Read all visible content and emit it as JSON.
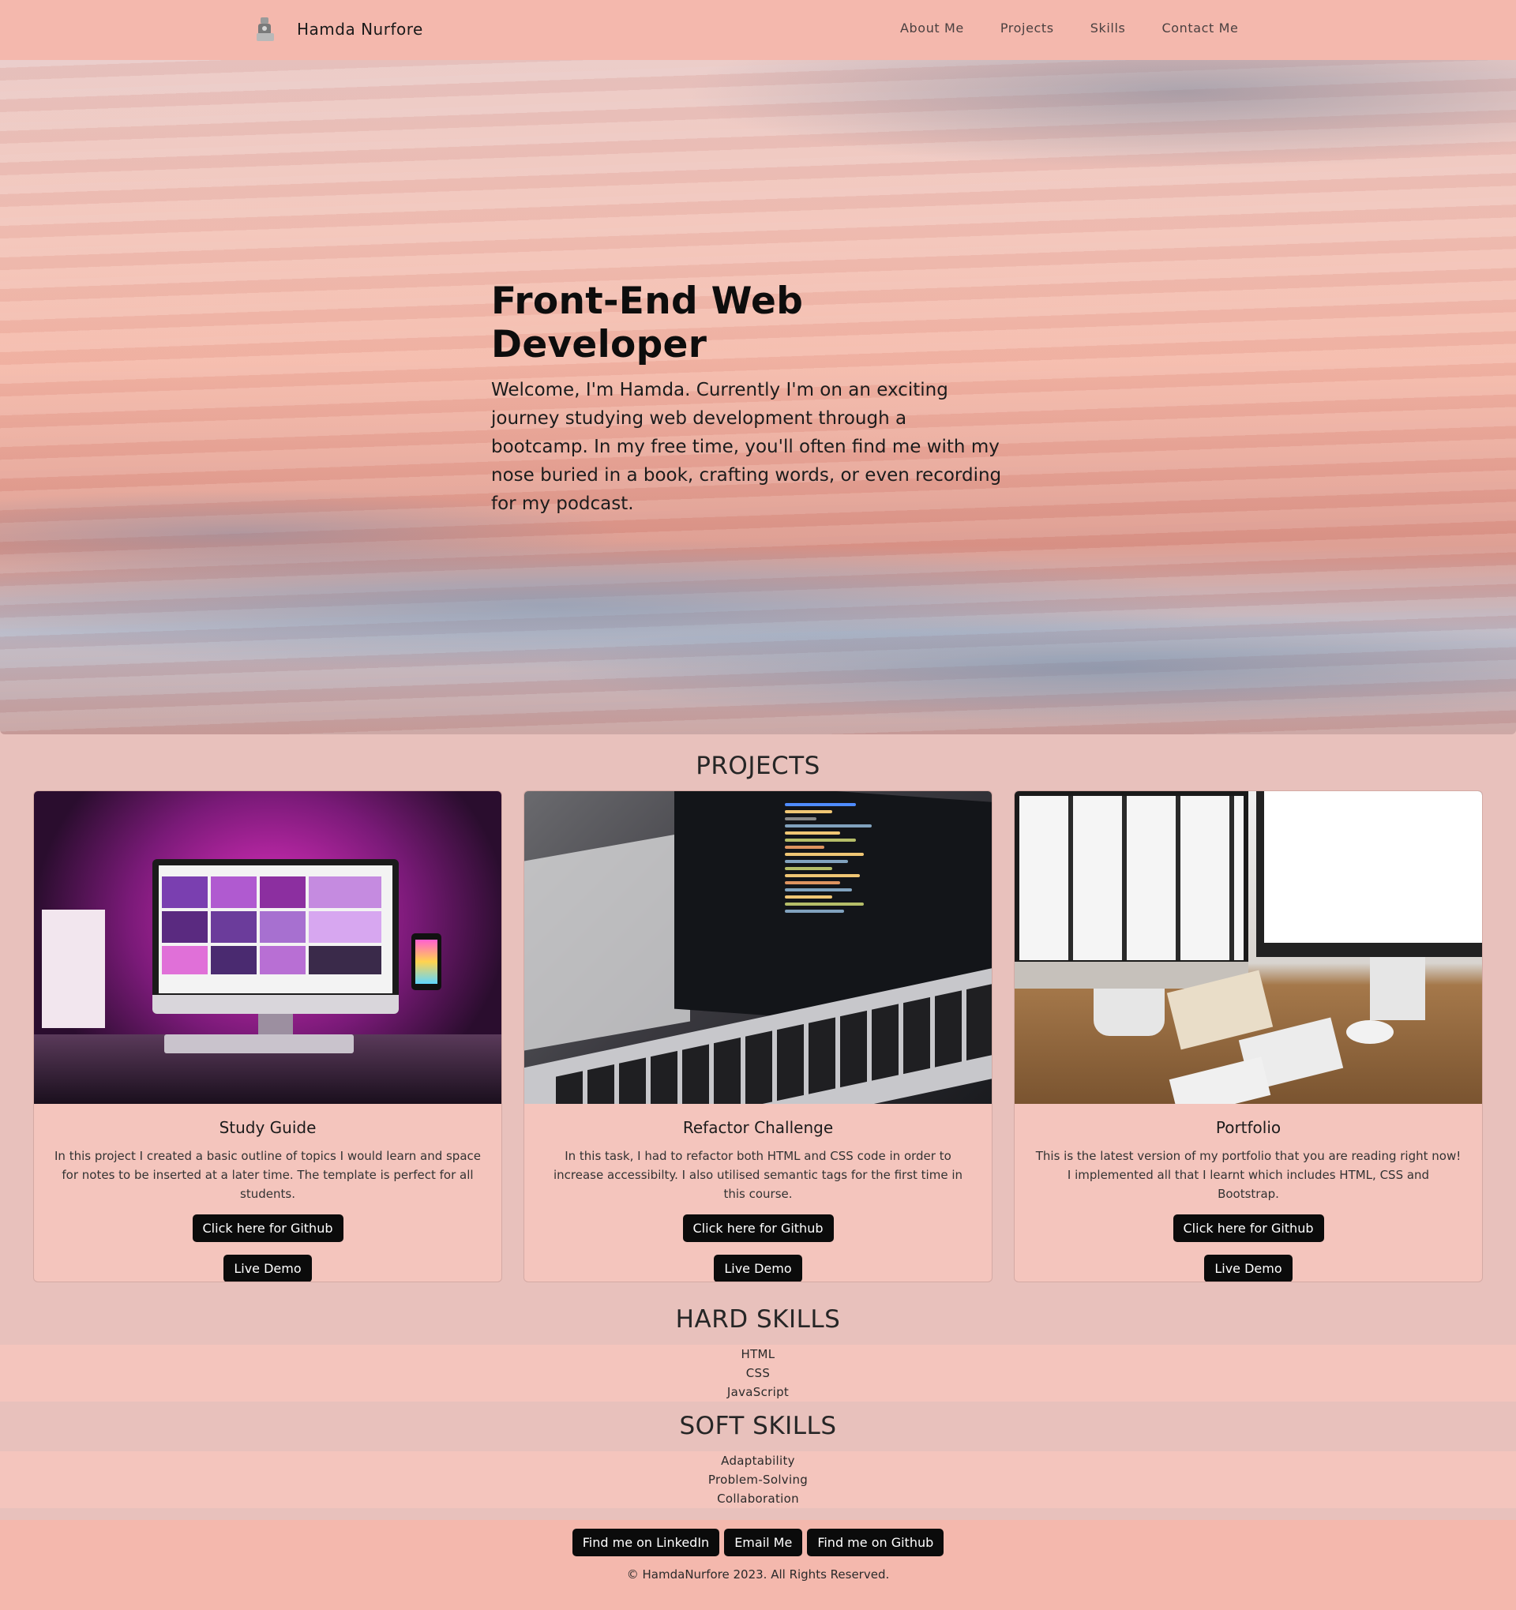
{
  "nav": {
    "brand": "Hamda Nurfore",
    "links": [
      "About Me",
      "Projects",
      "Skills",
      "Contact Me"
    ]
  },
  "hero": {
    "title": "Front-End Web Developer",
    "text": "Welcome, I'm Hamda. Currently I'm on an exciting journey studying web development through a bootcamp. In my free time, you'll often find me with my nose buried in a book, crafting words, or even recording for my podcast."
  },
  "projects": {
    "title": "PROJECTS",
    "cards": [
      {
        "title": "Study Guide",
        "text": "In this project I created a basic outline of topics I would learn and space for notes to be inserted at a later time. The template is perfect for all students.",
        "github_label": "Click here for Github",
        "demo_label": "Live Demo"
      },
      {
        "title": "Refactor Challenge",
        "text": "In this task, I had to refactor both HTML and CSS code in order to increase accessibilty. I also utilised semantic tags for the first time in this course.",
        "github_label": "Click here for Github",
        "demo_label": "Live Demo"
      },
      {
        "title": "Portfolio",
        "text": "This is the latest version of my portfolio that you are reading right now! I implemented all that I learnt which includes HTML, CSS and Bootstrap.",
        "github_label": "Click here for Github",
        "demo_label": "Live Demo"
      }
    ]
  },
  "hard_skills": {
    "title": "HARD SKILLS",
    "items": [
      "HTML",
      "CSS",
      "JavaScript"
    ]
  },
  "soft_skills": {
    "title": "SOFT SKILLS",
    "items": [
      "Adaptability",
      "Problem-Solving",
      "Collaboration"
    ]
  },
  "footer": {
    "linkedin_label": "Find me on LinkedIn",
    "email_label": "Email Me",
    "github_label": "Find me on Github",
    "copyright": "© HamdaNurfore 2023. All Rights Reserved."
  },
  "colors": {
    "navbar_bg": "#f4b8ad",
    "page_bg": "#e8c1bc",
    "card_bg": "#f4c5bd",
    "button_bg": "#0b0b0b"
  }
}
